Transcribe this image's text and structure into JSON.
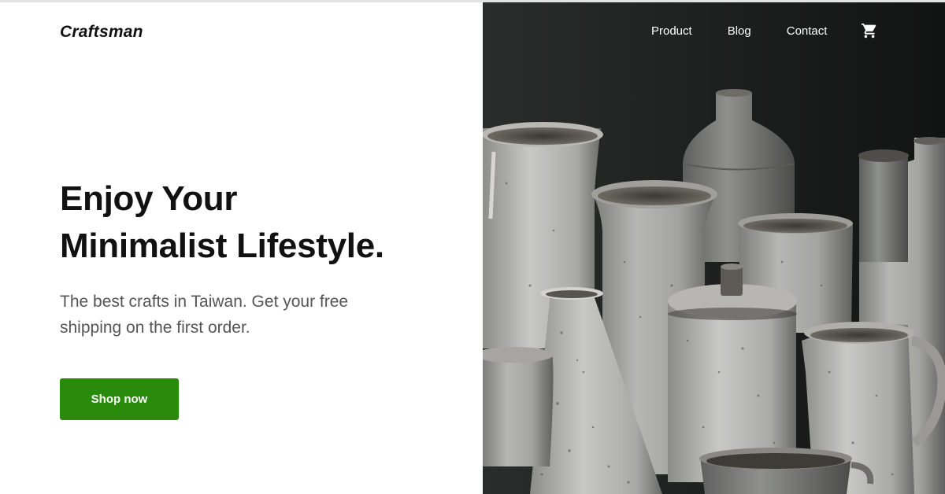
{
  "brand": {
    "logo": "Craftsman"
  },
  "nav": {
    "items": [
      {
        "label": "Product"
      },
      {
        "label": "Blog"
      },
      {
        "label": "Contact"
      }
    ],
    "cart_icon": "cart-icon"
  },
  "hero": {
    "headline_line1": "Enjoy Your",
    "headline_line2": "Minimalist Lifestyle.",
    "subtext": "The best crafts in Taiwan. Get your free shipping on the first order.",
    "cta_label": "Shop now"
  },
  "colors": {
    "accent": "#2a8a0b",
    "text": "#111111",
    "muted": "#555555",
    "photo_bg": "#1f2020"
  }
}
